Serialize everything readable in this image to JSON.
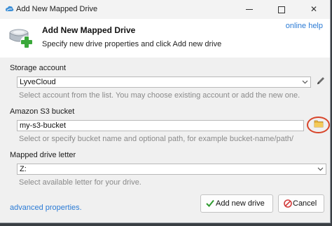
{
  "window": {
    "title": "Add New Mapped Drive"
  },
  "header": {
    "title": "Add New Mapped Drive",
    "subtitle": "Specify new drive properties and click Add new drive",
    "help_link": "online help"
  },
  "storage_account": {
    "label": "Storage account",
    "value": "LyveCloud",
    "hint": "Select account from the list. You may choose existing account or add the new one."
  },
  "bucket": {
    "label": "Amazon S3 bucket",
    "value": "my-s3-bucket",
    "hint": "Select or specify bucket name and optional path, for example bucket-name/path/"
  },
  "drive_letter": {
    "label": "Mapped drive letter",
    "value": "Z:",
    "hint": "Select available letter for your drive."
  },
  "footer": {
    "advanced_link": "advanced properties.",
    "add_button": "Add new drive",
    "cancel_button": "Cancel"
  },
  "colors": {
    "link": "#2b7bd5",
    "highlight_ring": "#d8452a",
    "add_check": "#2e9a2e",
    "cancel_icon": "#d23c3c"
  },
  "icons": [
    "app-cloud-icon",
    "network-drive-add-icon",
    "edit-pencil-icon",
    "folder-icon",
    "checkmark-icon",
    "cancel-icon",
    "chevron-down-icon"
  ]
}
